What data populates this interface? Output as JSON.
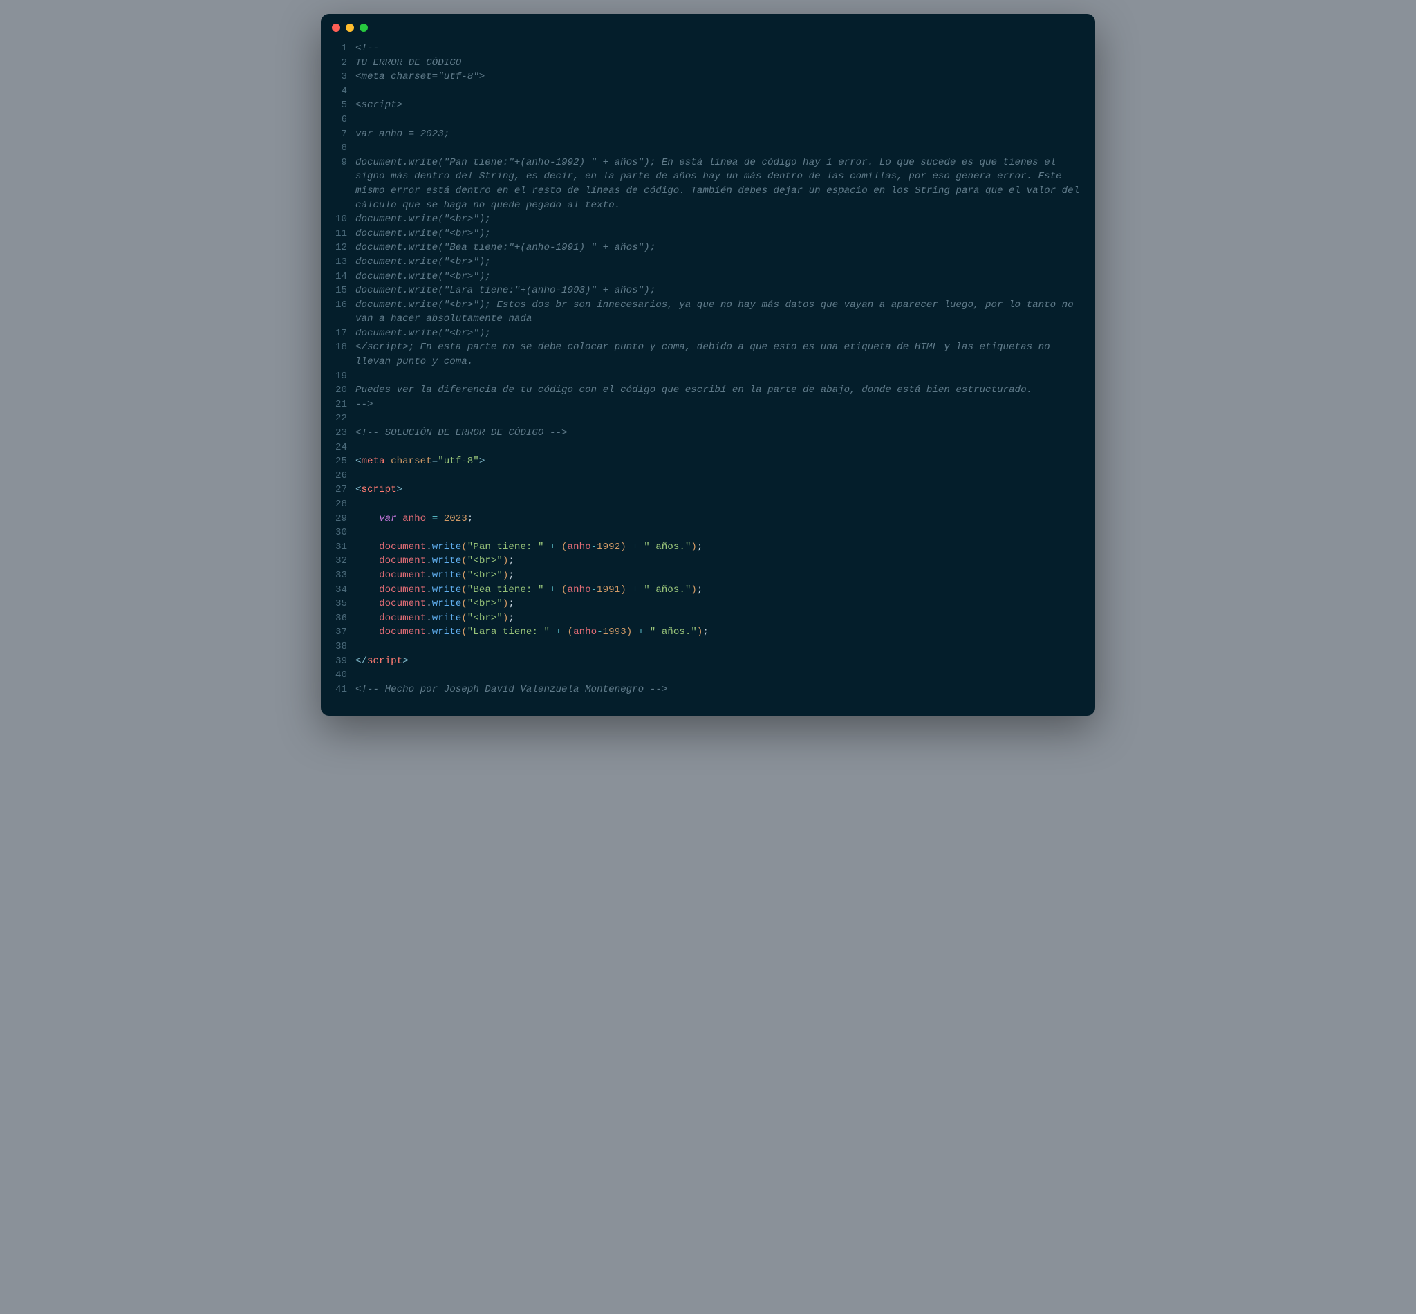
{
  "window": {
    "traffic": {
      "close": "close",
      "min": "minimize",
      "max": "maximize"
    }
  },
  "lines": [
    {
      "n": "1",
      "tokens": [
        {
          "c": "cm",
          "t": "<!--"
        }
      ]
    },
    {
      "n": "2",
      "tokens": [
        {
          "c": "cm",
          "t": "TU ERROR DE CÓDIGO"
        }
      ]
    },
    {
      "n": "3",
      "tokens": [
        {
          "c": "cm",
          "t": "<meta charset=\"utf-8\">"
        }
      ]
    },
    {
      "n": "4",
      "tokens": [
        {
          "c": "cm",
          "t": ""
        }
      ]
    },
    {
      "n": "5",
      "tokens": [
        {
          "c": "cm",
          "t": "<script>"
        }
      ]
    },
    {
      "n": "6",
      "tokens": [
        {
          "c": "cm",
          "t": ""
        }
      ]
    },
    {
      "n": "7",
      "tokens": [
        {
          "c": "cm",
          "t": "var anho = 2023;"
        }
      ]
    },
    {
      "n": "8",
      "tokens": [
        {
          "c": "cm",
          "t": ""
        }
      ]
    },
    {
      "n": "9",
      "tokens": [
        {
          "c": "cm",
          "t": "document.write(\"Pan tiene:\"+(anho-1992) \" + años\"); En está línea de código hay 1 error. Lo que sucede es que tienes el signo más dentro del String, es decir, en la parte de años hay un más dentro de las comillas, por eso genera error. Este mismo error está dentro en el resto de líneas de código. También debes dejar un espacio en los String para que el valor del cálculo que se haga no quede pegado al texto."
        }
      ]
    },
    {
      "n": "10",
      "tokens": [
        {
          "c": "cm",
          "t": "document.write(\"<br>\");"
        }
      ]
    },
    {
      "n": "11",
      "tokens": [
        {
          "c": "cm",
          "t": "document.write(\"<br>\");"
        }
      ]
    },
    {
      "n": "12",
      "tokens": [
        {
          "c": "cm",
          "t": "document.write(\"Bea tiene:\"+(anho-1991) \" + años\");"
        }
      ]
    },
    {
      "n": "13",
      "tokens": [
        {
          "c": "cm",
          "t": "document.write(\"<br>\");"
        }
      ]
    },
    {
      "n": "14",
      "tokens": [
        {
          "c": "cm",
          "t": "document.write(\"<br>\");"
        }
      ]
    },
    {
      "n": "15",
      "tokens": [
        {
          "c": "cm",
          "t": "document.write(\"Lara tiene:\"+(anho-1993)\" + años\");"
        }
      ]
    },
    {
      "n": "16",
      "tokens": [
        {
          "c": "cm",
          "t": "document.write(\"<br>\"); Estos dos br son innecesarios, ya que no hay más datos que vayan a aparecer luego, por lo tanto no van a hacer absolutamente nada"
        }
      ]
    },
    {
      "n": "17",
      "tokens": [
        {
          "c": "cm",
          "t": "document.write(\"<br>\");"
        }
      ]
    },
    {
      "n": "18",
      "tokens": [
        {
          "c": "cm",
          "t": "</script>; En esta parte no se debe colocar punto y coma, debido a que esto es una etiqueta de HTML y las etiquetas no llevan punto y coma."
        }
      ]
    },
    {
      "n": "19",
      "tokens": [
        {
          "c": "cm",
          "t": ""
        }
      ]
    },
    {
      "n": "20",
      "tokens": [
        {
          "c": "cm",
          "t": "Puedes ver la diferencia de tu código con el código que escribí en la parte de abajo, donde está bien estructurado."
        }
      ]
    },
    {
      "n": "21",
      "tokens": [
        {
          "c": "cm",
          "t": "-->"
        }
      ]
    },
    {
      "n": "22",
      "tokens": [
        {
          "c": "id",
          "t": ""
        }
      ]
    },
    {
      "n": "23",
      "tokens": [
        {
          "c": "cm",
          "t": "<!-- SOLUCIÓN DE ERROR DE CÓDIGO -->"
        }
      ]
    },
    {
      "n": "24",
      "tokens": [
        {
          "c": "id",
          "t": ""
        }
      ]
    },
    {
      "n": "25",
      "tokens": [
        {
          "c": "pn",
          "t": "<"
        },
        {
          "c": "tg",
          "t": "meta"
        },
        {
          "c": "id",
          "t": " "
        },
        {
          "c": "at",
          "t": "charset"
        },
        {
          "c": "pn",
          "t": "="
        },
        {
          "c": "st",
          "t": "\"utf-8\""
        },
        {
          "c": "pn",
          "t": ">"
        }
      ]
    },
    {
      "n": "26",
      "tokens": [
        {
          "c": "id",
          "t": ""
        }
      ]
    },
    {
      "n": "27",
      "tokens": [
        {
          "c": "pn",
          "t": "<"
        },
        {
          "c": "tg",
          "t": "script"
        },
        {
          "c": "pn",
          "t": ">"
        }
      ]
    },
    {
      "n": "28",
      "tokens": [
        {
          "c": "id",
          "t": ""
        }
      ]
    },
    {
      "n": "29",
      "tokens": [
        {
          "c": "id",
          "t": "    "
        },
        {
          "c": "kw",
          "t": "var"
        },
        {
          "c": "id",
          "t": " "
        },
        {
          "c": "vn",
          "t": "anho"
        },
        {
          "c": "id",
          "t": " "
        },
        {
          "c": "op",
          "t": "="
        },
        {
          "c": "id",
          "t": " "
        },
        {
          "c": "nm",
          "t": "2023"
        },
        {
          "c": "id",
          "t": ";"
        }
      ]
    },
    {
      "n": "30",
      "tokens": [
        {
          "c": "id",
          "t": ""
        }
      ]
    },
    {
      "n": "31",
      "tokens": [
        {
          "c": "id",
          "t": "    "
        },
        {
          "c": "vn",
          "t": "document"
        },
        {
          "c": "id",
          "t": "."
        },
        {
          "c": "fn",
          "t": "write"
        },
        {
          "c": "br",
          "t": "("
        },
        {
          "c": "st",
          "t": "\"Pan tiene: \""
        },
        {
          "c": "id",
          "t": " "
        },
        {
          "c": "op",
          "t": "+"
        },
        {
          "c": "id",
          "t": " "
        },
        {
          "c": "br",
          "t": "("
        },
        {
          "c": "vn",
          "t": "anho"
        },
        {
          "c": "op",
          "t": "-"
        },
        {
          "c": "nm",
          "t": "1992"
        },
        {
          "c": "br",
          "t": ")"
        },
        {
          "c": "id",
          "t": " "
        },
        {
          "c": "op",
          "t": "+"
        },
        {
          "c": "id",
          "t": " "
        },
        {
          "c": "st",
          "t": "\" años.\""
        },
        {
          "c": "br",
          "t": ")"
        },
        {
          "c": "id",
          "t": ";"
        }
      ]
    },
    {
      "n": "32",
      "tokens": [
        {
          "c": "id",
          "t": "    "
        },
        {
          "c": "vn",
          "t": "document"
        },
        {
          "c": "id",
          "t": "."
        },
        {
          "c": "fn",
          "t": "write"
        },
        {
          "c": "br",
          "t": "("
        },
        {
          "c": "st",
          "t": "\"<br>\""
        },
        {
          "c": "br",
          "t": ")"
        },
        {
          "c": "id",
          "t": ";"
        }
      ]
    },
    {
      "n": "33",
      "tokens": [
        {
          "c": "id",
          "t": "    "
        },
        {
          "c": "vn",
          "t": "document"
        },
        {
          "c": "id",
          "t": "."
        },
        {
          "c": "fn",
          "t": "write"
        },
        {
          "c": "br",
          "t": "("
        },
        {
          "c": "st",
          "t": "\"<br>\""
        },
        {
          "c": "br",
          "t": ")"
        },
        {
          "c": "id",
          "t": ";"
        }
      ]
    },
    {
      "n": "34",
      "tokens": [
        {
          "c": "id",
          "t": "    "
        },
        {
          "c": "vn",
          "t": "document"
        },
        {
          "c": "id",
          "t": "."
        },
        {
          "c": "fn",
          "t": "write"
        },
        {
          "c": "br",
          "t": "("
        },
        {
          "c": "st",
          "t": "\"Bea tiene: \""
        },
        {
          "c": "id",
          "t": " "
        },
        {
          "c": "op",
          "t": "+"
        },
        {
          "c": "id",
          "t": " "
        },
        {
          "c": "br",
          "t": "("
        },
        {
          "c": "vn",
          "t": "anho"
        },
        {
          "c": "op",
          "t": "-"
        },
        {
          "c": "nm",
          "t": "1991"
        },
        {
          "c": "br",
          "t": ")"
        },
        {
          "c": "id",
          "t": " "
        },
        {
          "c": "op",
          "t": "+"
        },
        {
          "c": "id",
          "t": " "
        },
        {
          "c": "st",
          "t": "\" años.\""
        },
        {
          "c": "br",
          "t": ")"
        },
        {
          "c": "id",
          "t": ";"
        }
      ]
    },
    {
      "n": "35",
      "tokens": [
        {
          "c": "id",
          "t": "    "
        },
        {
          "c": "vn",
          "t": "document"
        },
        {
          "c": "id",
          "t": "."
        },
        {
          "c": "fn",
          "t": "write"
        },
        {
          "c": "br",
          "t": "("
        },
        {
          "c": "st",
          "t": "\"<br>\""
        },
        {
          "c": "br",
          "t": ")"
        },
        {
          "c": "id",
          "t": ";"
        }
      ]
    },
    {
      "n": "36",
      "tokens": [
        {
          "c": "id",
          "t": "    "
        },
        {
          "c": "vn",
          "t": "document"
        },
        {
          "c": "id",
          "t": "."
        },
        {
          "c": "fn",
          "t": "write"
        },
        {
          "c": "br",
          "t": "("
        },
        {
          "c": "st",
          "t": "\"<br>\""
        },
        {
          "c": "br",
          "t": ")"
        },
        {
          "c": "id",
          "t": ";"
        }
      ]
    },
    {
      "n": "37",
      "tokens": [
        {
          "c": "id",
          "t": "    "
        },
        {
          "c": "vn",
          "t": "document"
        },
        {
          "c": "id",
          "t": "."
        },
        {
          "c": "fn",
          "t": "write"
        },
        {
          "c": "br",
          "t": "("
        },
        {
          "c": "st",
          "t": "\"Lara tiene: \""
        },
        {
          "c": "id",
          "t": " "
        },
        {
          "c": "op",
          "t": "+"
        },
        {
          "c": "id",
          "t": " "
        },
        {
          "c": "br",
          "t": "("
        },
        {
          "c": "vn",
          "t": "anho"
        },
        {
          "c": "op",
          "t": "-"
        },
        {
          "c": "nm",
          "t": "1993"
        },
        {
          "c": "br",
          "t": ")"
        },
        {
          "c": "id",
          "t": " "
        },
        {
          "c": "op",
          "t": "+"
        },
        {
          "c": "id",
          "t": " "
        },
        {
          "c": "st",
          "t": "\" años.\""
        },
        {
          "c": "br",
          "t": ")"
        },
        {
          "c": "id",
          "t": ";"
        }
      ]
    },
    {
      "n": "38",
      "tokens": [
        {
          "c": "id",
          "t": ""
        }
      ]
    },
    {
      "n": "39",
      "tokens": [
        {
          "c": "pn",
          "t": "</"
        },
        {
          "c": "tg",
          "t": "script"
        },
        {
          "c": "pn",
          "t": ">"
        }
      ]
    },
    {
      "n": "40",
      "tokens": [
        {
          "c": "id",
          "t": ""
        }
      ]
    },
    {
      "n": "41",
      "tokens": [
        {
          "c": "cm",
          "t": "<!-- Hecho por Joseph David Valenzuela Montenegro -->"
        }
      ]
    }
  ]
}
